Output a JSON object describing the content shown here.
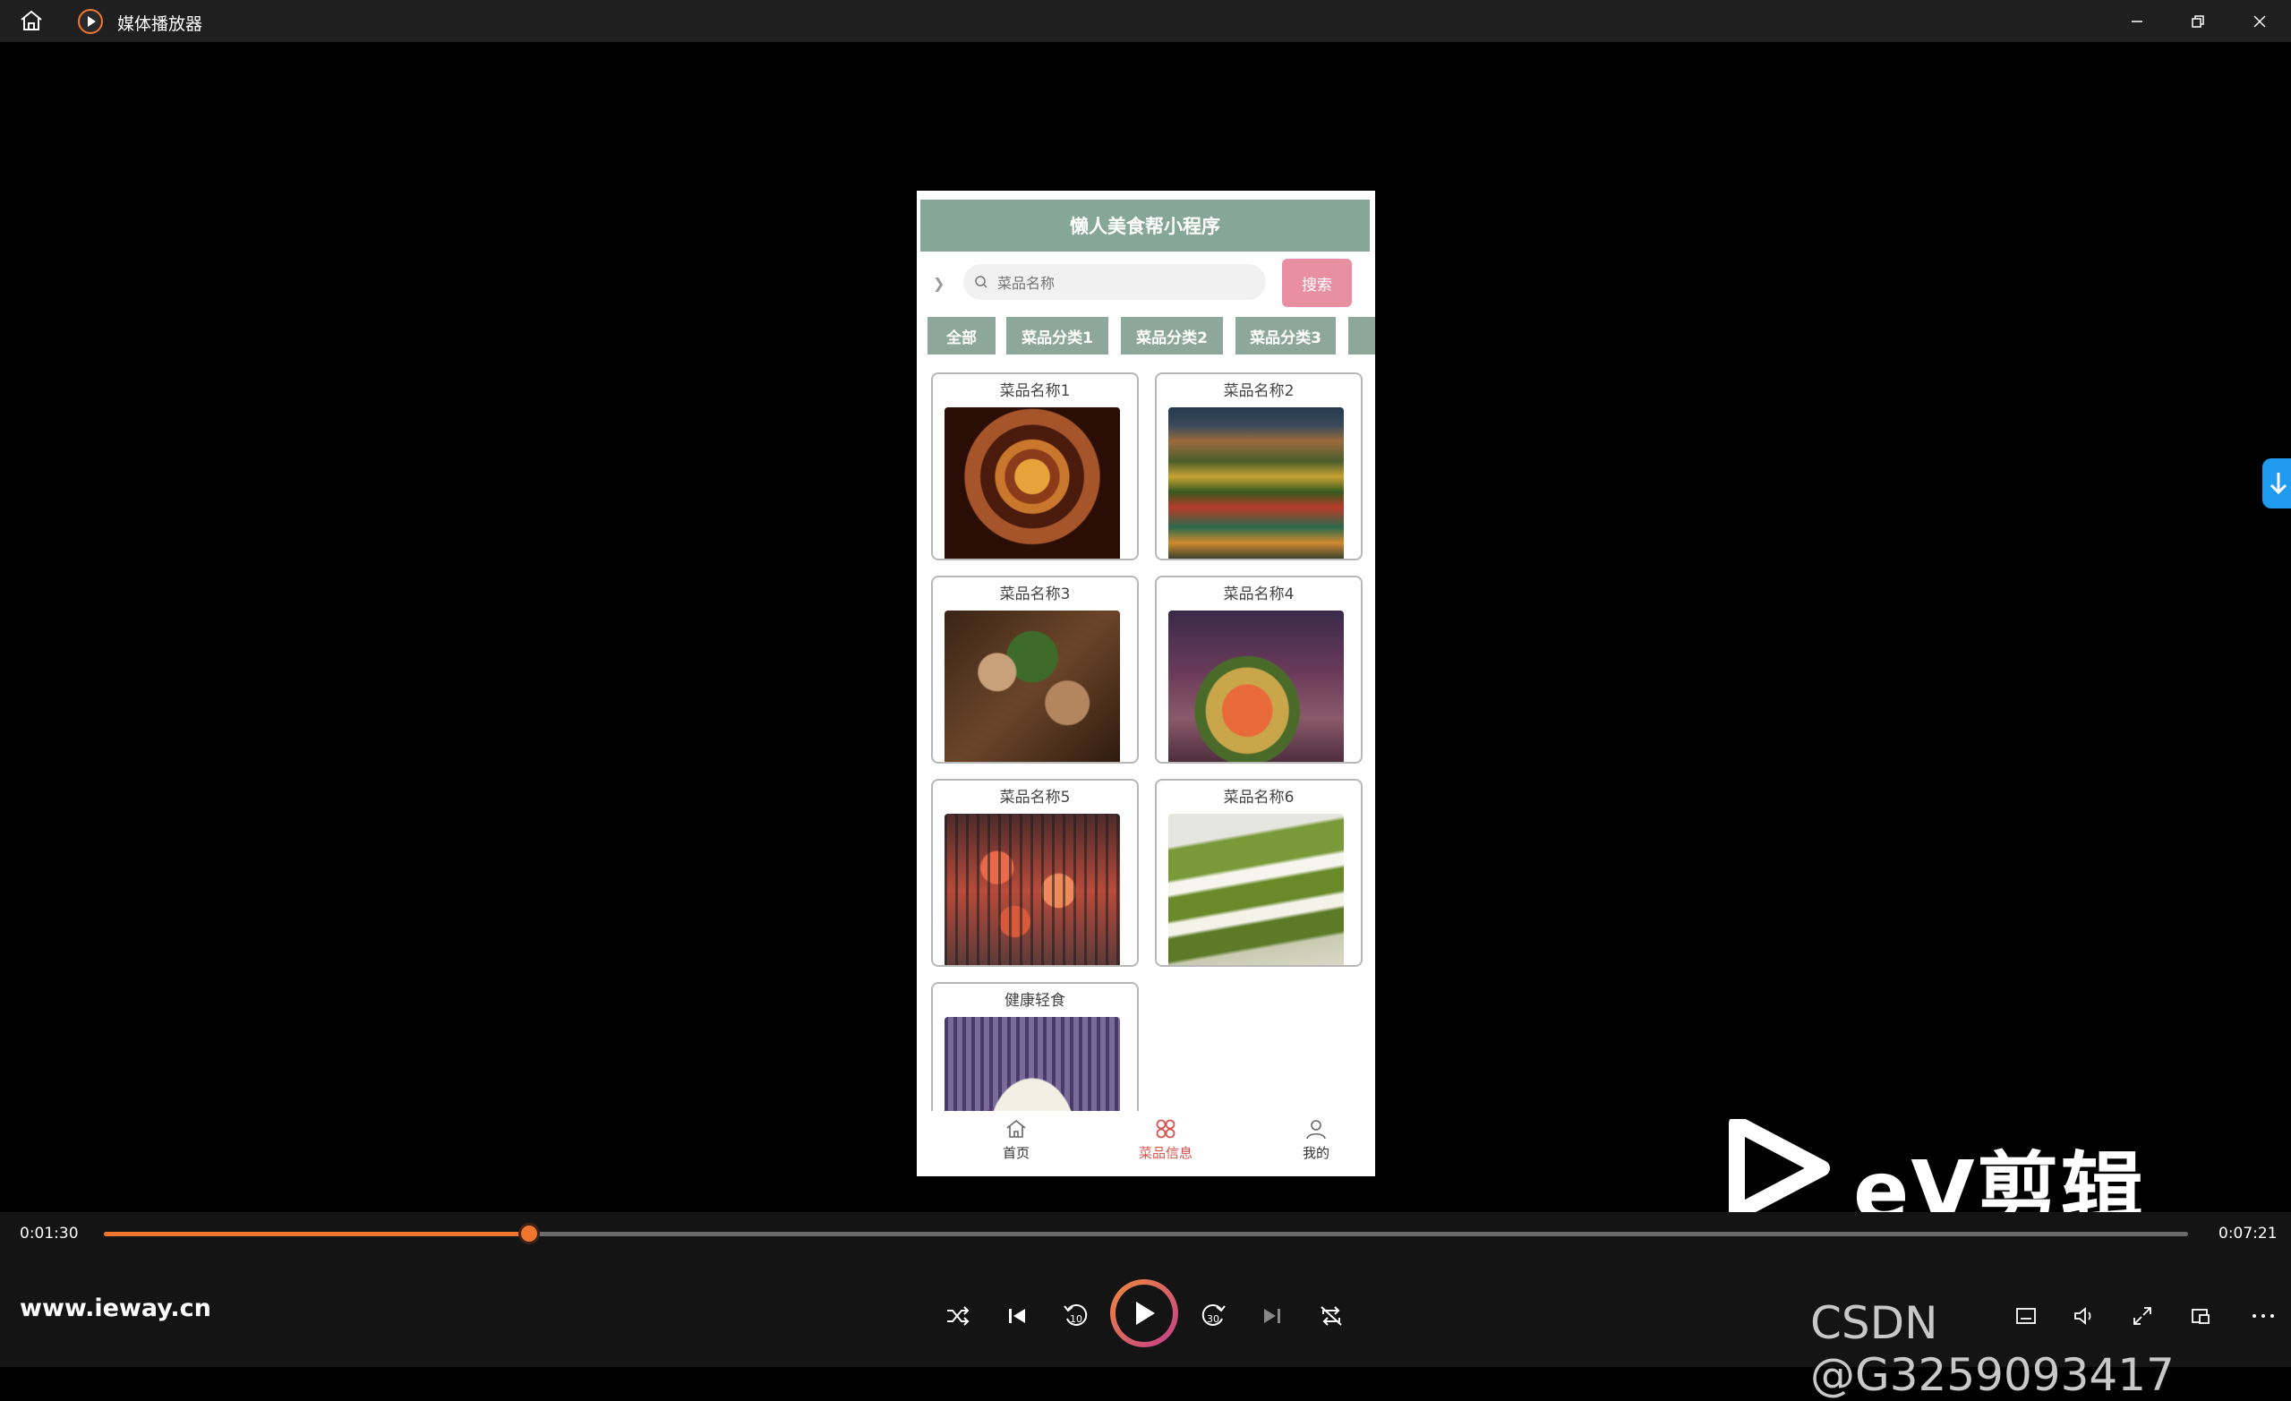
{
  "window": {
    "title": "媒体播放器",
    "home_icon": "home-icon",
    "app_icon": "media-player-icon"
  },
  "phone": {
    "header_title": "懒人美食帮小程序",
    "search": {
      "placeholder": "菜品名称",
      "button": "搜索"
    },
    "categories": [
      "全部",
      "菜品分类1",
      "菜品分类2",
      "菜品分类3"
    ],
    "dishes": [
      {
        "name": "菜品名称1",
        "image": "hotpot-photo"
      },
      {
        "name": "菜品名称2",
        "image": "burger-photo"
      },
      {
        "name": "菜品名称3",
        "image": "grilled-meat-photo"
      },
      {
        "name": "菜品名称4",
        "image": "platter-photo"
      },
      {
        "name": "菜品名称5",
        "image": "grilled-shrimp-photo"
      },
      {
        "name": "菜品名称6",
        "image": "matcha-cake-photo"
      },
      {
        "name": "健康轻食",
        "image": "salad-photo"
      }
    ],
    "tabs": [
      {
        "label": "首页",
        "icon": "home-icon",
        "active": false
      },
      {
        "label": "菜品信息",
        "icon": "grid-icon",
        "active": true
      },
      {
        "label": "我的",
        "icon": "user-icon",
        "active": false
      }
    ],
    "colors": {
      "header": "#86a69a",
      "search_button": "#e98fa3",
      "active_tab": "#d9534f"
    }
  },
  "watermark": {
    "text": "eV剪辑"
  },
  "player": {
    "current_time": "0:01:30",
    "total_time": "0:07:21",
    "progress": 0.204,
    "site": "www.ieway.cn",
    "accent": "#f0762d",
    "overlay_text": "CSDN @G3259093417"
  }
}
